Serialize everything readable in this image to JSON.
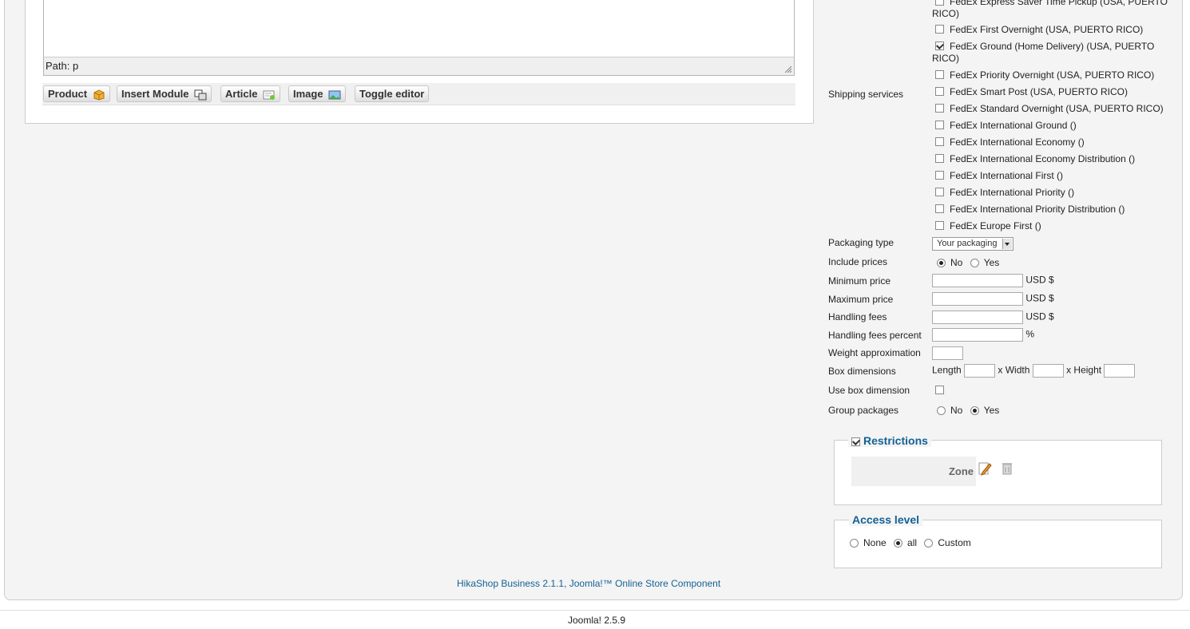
{
  "editor": {
    "path_label": "Path: p",
    "buttons": {
      "product": "Product",
      "insert_module": "Insert Module",
      "article": "Article",
      "image": "Image",
      "toggle_editor": "Toggle editor"
    }
  },
  "shipping": {
    "services_label": "Shipping services",
    "services": [
      {
        "label": "FedEx Express Saver Time Pickup (USA, PUERTO RICO)",
        "checked": false
      },
      {
        "label": "FedEx First Overnight (USA, PUERTO RICO)",
        "checked": false
      },
      {
        "label": "FedEx Ground (Home Delivery) (USA, PUERTO RICO)",
        "checked": true
      },
      {
        "label": "FedEx Priority Overnight (USA, PUERTO RICO)",
        "checked": false
      },
      {
        "label": "FedEx Smart Post (USA, PUERTO RICO)",
        "checked": false
      },
      {
        "label": "FedEx Standard Overnight (USA, PUERTO RICO)",
        "checked": false
      },
      {
        "label": "FedEx International Ground ()",
        "checked": false
      },
      {
        "label": "FedEx International Economy ()",
        "checked": false
      },
      {
        "label": "FedEx International Economy Distribution ()",
        "checked": false
      },
      {
        "label": "FedEx International First ()",
        "checked": false
      },
      {
        "label": "FedEx International Priority ()",
        "checked": false
      },
      {
        "label": "FedEx International Priority Distribution ()",
        "checked": false
      },
      {
        "label": "FedEx Europe First ()",
        "checked": false
      }
    ],
    "packaging_type_label": "Packaging type",
    "packaging_type_value": "Your packaging",
    "include_prices_label": "Include prices",
    "include_prices": {
      "no": "No",
      "yes": "Yes",
      "selected": "No"
    },
    "minimum_price_label": "Minimum price",
    "maximum_price_label": "Maximum price",
    "handling_fees_label": "Handling fees",
    "handling_fees_percent_label": "Handling fees percent",
    "currency": "USD $",
    "percent_sign": "%",
    "weight_approximation_label": "Weight approximation",
    "box_dimensions_label": "Box dimensions",
    "length_label": "Length",
    "width_label": "x Width",
    "height_label": "x Height",
    "use_box_dimension_label": "Use box dimension",
    "group_packages_label": "Group packages",
    "group_packages": {
      "no": "No",
      "yes": "Yes",
      "selected": "Yes"
    }
  },
  "restrictions": {
    "legend": "Restrictions",
    "checked": true,
    "zone_label": "Zone"
  },
  "access_level": {
    "legend": "Access level",
    "options": [
      "None",
      "all",
      "Custom"
    ],
    "selected": "all"
  },
  "footer": {
    "credit": "HikaShop Business 2.1.1, Joomla!™ Online Store Component",
    "version": "Joomla! 2.5.9"
  },
  "colors": {
    "accent": "#146295",
    "panel_bg": "#f4f4f4"
  }
}
